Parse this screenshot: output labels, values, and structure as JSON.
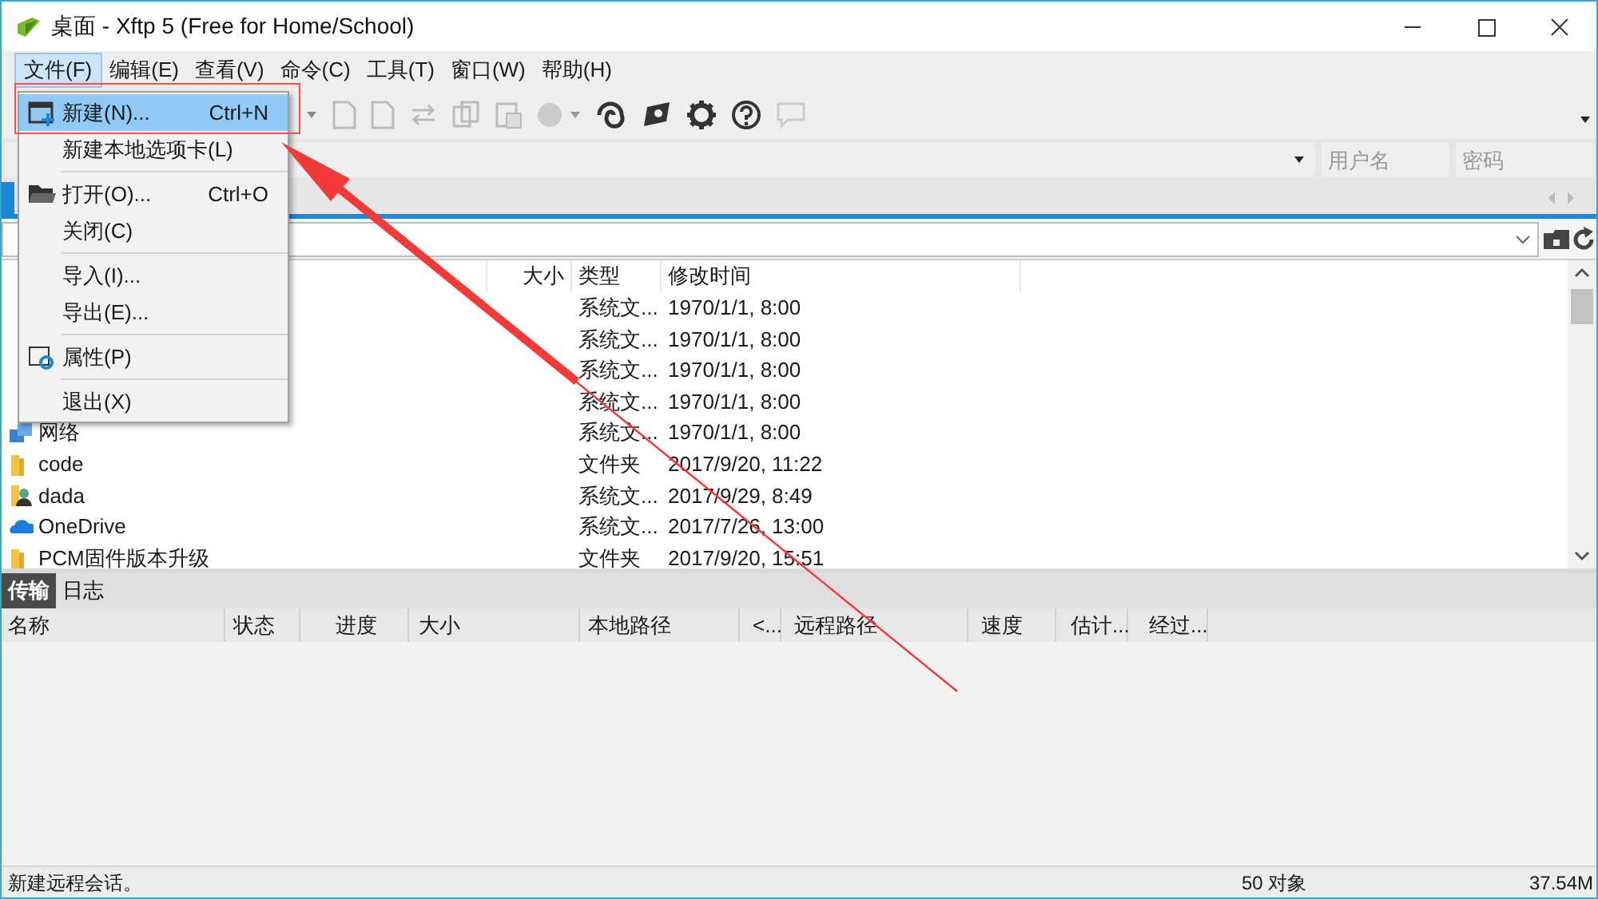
{
  "window": {
    "title": "桌面 - Xftp 5 (Free for Home/School)"
  },
  "menu_bar": [
    {
      "label": "文件(F)",
      "selected": true
    },
    {
      "label": "编辑(E)",
      "selected": false
    },
    {
      "label": "查看(V)",
      "selected": false
    },
    {
      "label": "命令(C)",
      "selected": false
    },
    {
      "label": "工具(T)",
      "selected": false
    },
    {
      "label": "窗口(W)",
      "selected": false
    },
    {
      "label": "帮助(H)",
      "selected": false
    }
  ],
  "file_menu": [
    {
      "kind": "item",
      "label": "新建(N)...",
      "shortcut": "Ctrl+N",
      "selected": true
    },
    {
      "kind": "item",
      "label": "新建本地选项卡(L)",
      "selected": false
    },
    {
      "kind": "separator"
    },
    {
      "kind": "item",
      "label": "打开(O)...",
      "shortcut": "Ctrl+O",
      "selected": false
    },
    {
      "kind": "item",
      "label": "关闭(C)",
      "selected": false
    },
    {
      "kind": "separator"
    },
    {
      "kind": "item",
      "label": "导入(I)...",
      "selected": false
    },
    {
      "kind": "item",
      "label": "导出(E)...",
      "selected": false
    },
    {
      "kind": "separator"
    },
    {
      "kind": "item",
      "label": "属性(P)",
      "selected": false
    },
    {
      "kind": "separator"
    },
    {
      "kind": "item",
      "label": "退出(X)",
      "selected": false
    }
  ],
  "connection_bar": {
    "username_placeholder": "用户名",
    "password_placeholder": "密码"
  },
  "file_list": {
    "columns": [
      "大小",
      "类型",
      "修改时间"
    ],
    "rows": [
      {
        "type": "系统文...",
        "modified": "1970/1/1, 8:00"
      },
      {
        "type": "系统文...",
        "modified": "1970/1/1, 8:00"
      },
      {
        "type": "系统文...",
        "modified": "1970/1/1, 8:00"
      },
      {
        "type": "系统文...",
        "modified": "1970/1/1, 8:00"
      },
      {
        "name": "网络",
        "kind": "network",
        "type": "系统文...",
        "modified": "1970/1/1, 8:00"
      },
      {
        "name": "code",
        "kind": "folder",
        "type": "文件夹",
        "modified": "2017/9/20, 11:22"
      },
      {
        "name": "dada",
        "kind": "user",
        "type": "系统文...",
        "modified": "2017/9/29, 8:49"
      },
      {
        "name": "OneDrive",
        "kind": "cloud",
        "type": "系统文...",
        "modified": "2017/7/26, 13:00"
      },
      {
        "name": "PCM固件版本升级",
        "kind": "folder",
        "type": "文件夹",
        "modified": "2017/9/20, 15:51"
      }
    ]
  },
  "transfer_panel": {
    "tabs": [
      {
        "label": "传输",
        "selected": true
      },
      {
        "label": "日志",
        "selected": false
      }
    ],
    "columns": [
      "名称",
      "状态",
      "进度",
      "大小",
      "本地路径",
      "<...",
      "远程路径",
      "速度",
      "估计...",
      "经过..."
    ]
  },
  "status_bar": {
    "message": "新建远程会话。",
    "object_count": "50 对象",
    "size": "37.54M"
  }
}
